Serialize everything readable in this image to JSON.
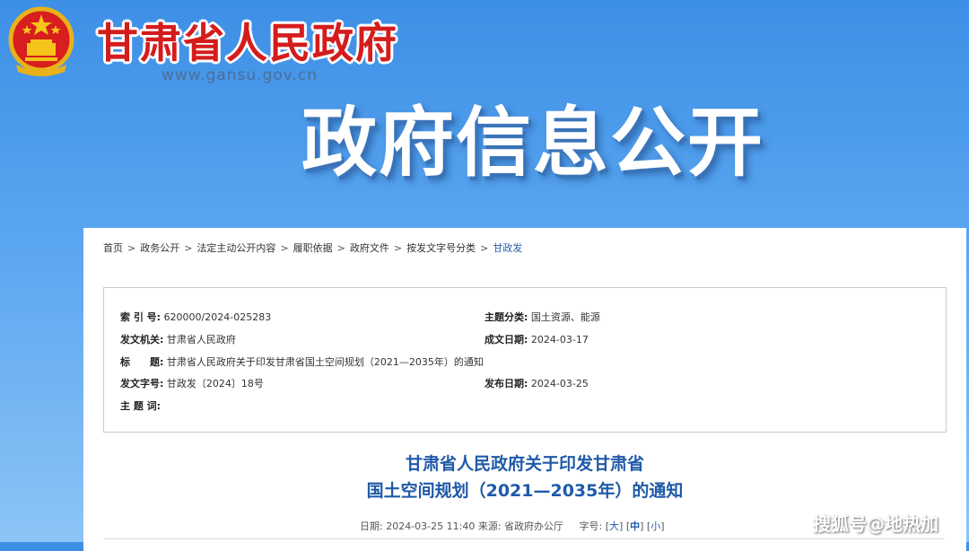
{
  "header": {
    "site_title": "甘肃省人民政府",
    "site_url": "www.gansu.gov.cn",
    "banner_title": "政府信息公开"
  },
  "breadcrumb": [
    {
      "label": "首页"
    },
    {
      "label": "政务公开"
    },
    {
      "label": "法定主动公开内容"
    },
    {
      "label": "履职依据"
    },
    {
      "label": "政府文件"
    },
    {
      "label": "按发文字号分类"
    },
    {
      "label": "甘政发"
    }
  ],
  "breadcrumb_separator": ">",
  "meta": {
    "index_no": {
      "label": "索 引 号:",
      "value": "620000/2024-025283"
    },
    "subject": {
      "label": "主题分类:",
      "value": "国土资源、能源"
    },
    "issuer": {
      "label": "发文机关:",
      "value": "甘肃省人民政府"
    },
    "created": {
      "label": "成文日期:",
      "value": "2024-03-17"
    },
    "title": {
      "label": "标　　题:",
      "value": "甘肃省人民政府关于印发甘肃省国土空间规划（2021—2035年）的通知"
    },
    "doc_no": {
      "label": "发文字号:",
      "value": "甘政发〔2024〕18号"
    },
    "published": {
      "label": "发布日期:",
      "value": "2024-03-25"
    },
    "keywords": {
      "label": "主 题 词:",
      "value": ""
    }
  },
  "document": {
    "title_line1": "甘肃省人民政府关于印发甘肃省",
    "title_line2": "国土空间规划（2021—2035年）的通知",
    "date_text": "日期: 2024-03-25 11:40",
    "source_text": "来源: 省政府办公厅",
    "font_label": "字号:",
    "font_large": "大",
    "font_medium": "中",
    "font_small": "小"
  },
  "watermark": "搜狐号@地热加",
  "colors": {
    "brand_red": "#d51c1c",
    "link_blue": "#1f5aa8",
    "banner_blue": "#3d8fe6"
  }
}
